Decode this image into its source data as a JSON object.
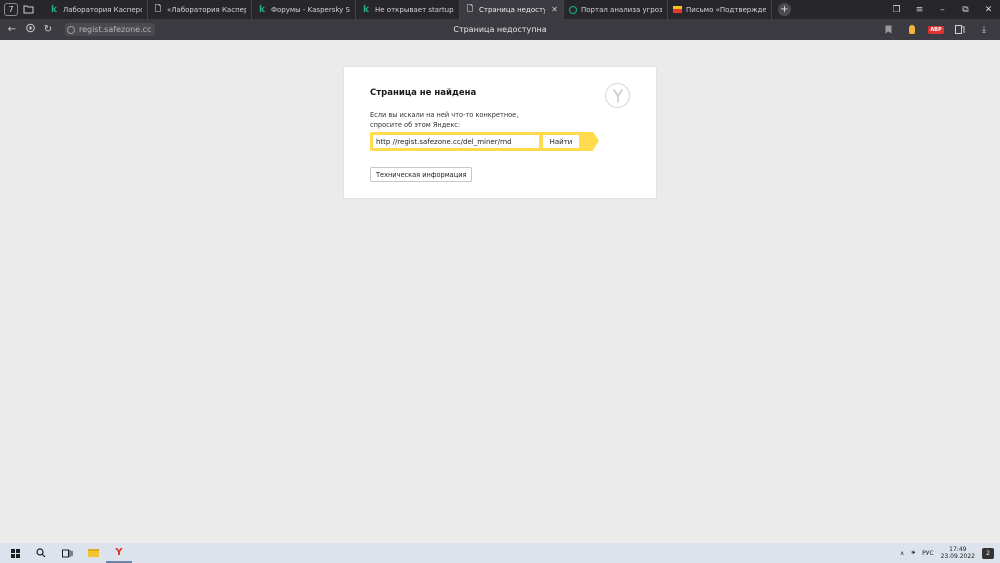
{
  "tabs": [
    {
      "label": "Лаборатория Касперско",
      "icon": "kaspersky-k-icon",
      "active": false
    },
    {
      "label": "«Лаборатория Касперско",
      "icon": "document-icon",
      "active": false
    },
    {
      "label": "Форумы - Kaspersky Supp",
      "icon": "kaspersky-k-icon",
      "active": false
    },
    {
      "label": "Не открывает startup - Ка",
      "icon": "kaspersky-k-icon",
      "active": false
    },
    {
      "label": "Страница недоступна",
      "icon": "document-icon",
      "active": true
    },
    {
      "label": "Портал анализа угроз Ка",
      "icon": "ring-icon",
      "active": false
    },
    {
      "label": "Письмо «Подтверждени",
      "icon": "mail-icon",
      "active": false
    }
  ],
  "tab_count_badge": "7",
  "address_bar": {
    "url": "regist.safezone.cc",
    "page_title": "Страница недоступна"
  },
  "error_page": {
    "title": "Страница не найдена",
    "hint_line1": "Если вы искали на ней что-то конкретное,",
    "hint_line2": "спросите об этом Яндекс:",
    "search_value": "http //regist.safezone.cc/del_miner/rnd",
    "search_button": "Найти",
    "tech_info_button": "Техническая информация"
  },
  "taskbar": {
    "language": "РУС",
    "time": "17:49",
    "date": "23.09.2022",
    "notification_count": "2"
  },
  "colors": {
    "accent_yellow": "#ffdb4d",
    "kaspersky_green": "#1fb57a",
    "tab_strip": "#26262b",
    "address_bar": "#3b3b41"
  }
}
